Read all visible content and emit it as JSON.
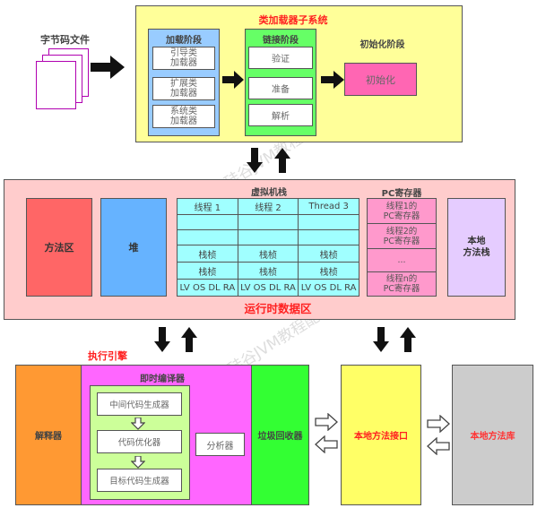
{
  "watermark": "尚硅谷JVM教程配图",
  "bytecode": {
    "label": "字节码文件",
    "icon": "documents-icon"
  },
  "class_loader_subsystem": {
    "title": "类加载器子系统",
    "loading": {
      "title": "加载阶段",
      "items": [
        "引导类\n加载器",
        "扩展类\n加载器",
        "系统类\n加载器"
      ]
    },
    "linking": {
      "title": "链接阶段",
      "items": [
        "验证",
        "准备",
        "解析"
      ]
    },
    "initialization": {
      "title": "初始化阶段",
      "item": "初始化"
    }
  },
  "runtime_data_area": {
    "title": "运行时数据区",
    "method_area": "方法区",
    "heap": "堆",
    "vm_stack": {
      "title": "虚拟机栈",
      "threads": [
        "线程 1",
        "线程 2",
        "Thread 3"
      ],
      "rows": [
        [
          "",
          "",
          ""
        ],
        [
          "",
          "",
          ""
        ],
        [
          "栈桢",
          "栈桢",
          "栈桢"
        ],
        [
          "栈桢",
          "栈桢",
          "栈桢"
        ],
        [
          "LV OS DL RA",
          "LV OS DL RA",
          "LV OS DL RA"
        ]
      ]
    },
    "pc_register": {
      "title": "PC寄存器",
      "items": [
        "线程1的\nPC寄存器",
        "线程2的\nPC寄存器",
        "...",
        "线程n的\nPC寄存器"
      ]
    },
    "native_method_stack": "本地\n方法栈"
  },
  "execution_engine": {
    "title": "执行引擎",
    "interpreter": "解释器",
    "jit": {
      "title": "即时编译器",
      "pipeline": [
        "中间代码生成器",
        "代码优化器",
        "目标代码生成器"
      ],
      "analyzer": "分析器"
    },
    "gc": "垃圾回收器"
  },
  "native_interface": "本地方法接口",
  "native_library": "本地方法库",
  "colors": {
    "class_loader_bg": "#ffff99",
    "loading_bg": "#99ccff",
    "linking_bg": "#66ff66",
    "init_bg": "#ff66b3",
    "runtime_bg": "#ffcccc",
    "method_area_bg": "#ff6666",
    "heap_bg": "#66b3ff",
    "stack_bg": "#a0ffff",
    "pc_bg": "#ff99cc",
    "native_stack_bg": "#e5ccff",
    "interpreter_bg": "#ff9933",
    "jit_bg": "#ff66ff",
    "jit_inner_bg": "#ccff99",
    "gc_bg": "#33ff33",
    "native_interface_bg": "#ffff66",
    "native_library_bg": "#cccccc",
    "title_red": "#ff2020"
  }
}
